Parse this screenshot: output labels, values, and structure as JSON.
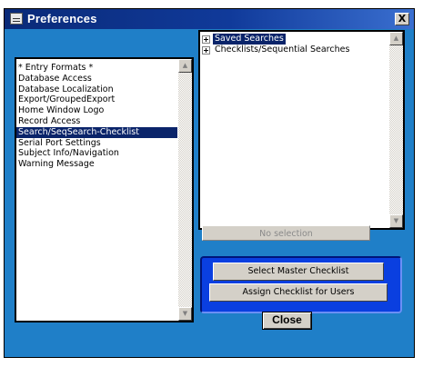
{
  "window": {
    "title": "Preferences",
    "close_glyph": "X",
    "app_icon": "preferences-icon",
    "background_color": "#1f7fc8"
  },
  "categories": {
    "items": [
      {
        "label": "* Entry Formats *",
        "selected": false
      },
      {
        "label": "Database Access",
        "selected": false
      },
      {
        "label": "Database Localization",
        "selected": false
      },
      {
        "label": "Export/GroupedExport",
        "selected": false
      },
      {
        "label": "Home Window Logo",
        "selected": false
      },
      {
        "label": "Record Access",
        "selected": false
      },
      {
        "label": "Search/SeqSearch-Checklist",
        "selected": true
      },
      {
        "label": "Serial Port Settings",
        "selected": false
      },
      {
        "label": "Subject Info/Navigation",
        "selected": false
      },
      {
        "label": "Warning Message",
        "selected": false
      }
    ]
  },
  "tree": {
    "items": [
      {
        "label": "Saved Searches",
        "selected": true
      },
      {
        "label": "Checklists/Sequential Searches",
        "selected": false
      }
    ]
  },
  "selection_status": "No selection",
  "checklist_panel": {
    "select_master_label": "Select Master Checklist",
    "assign_label": "Assign Checklist for Users",
    "panel_color": "#0a3fe0"
  },
  "close_label": "Close",
  "scroll_up_glyph": "▲",
  "scroll_down_glyph": "▼"
}
